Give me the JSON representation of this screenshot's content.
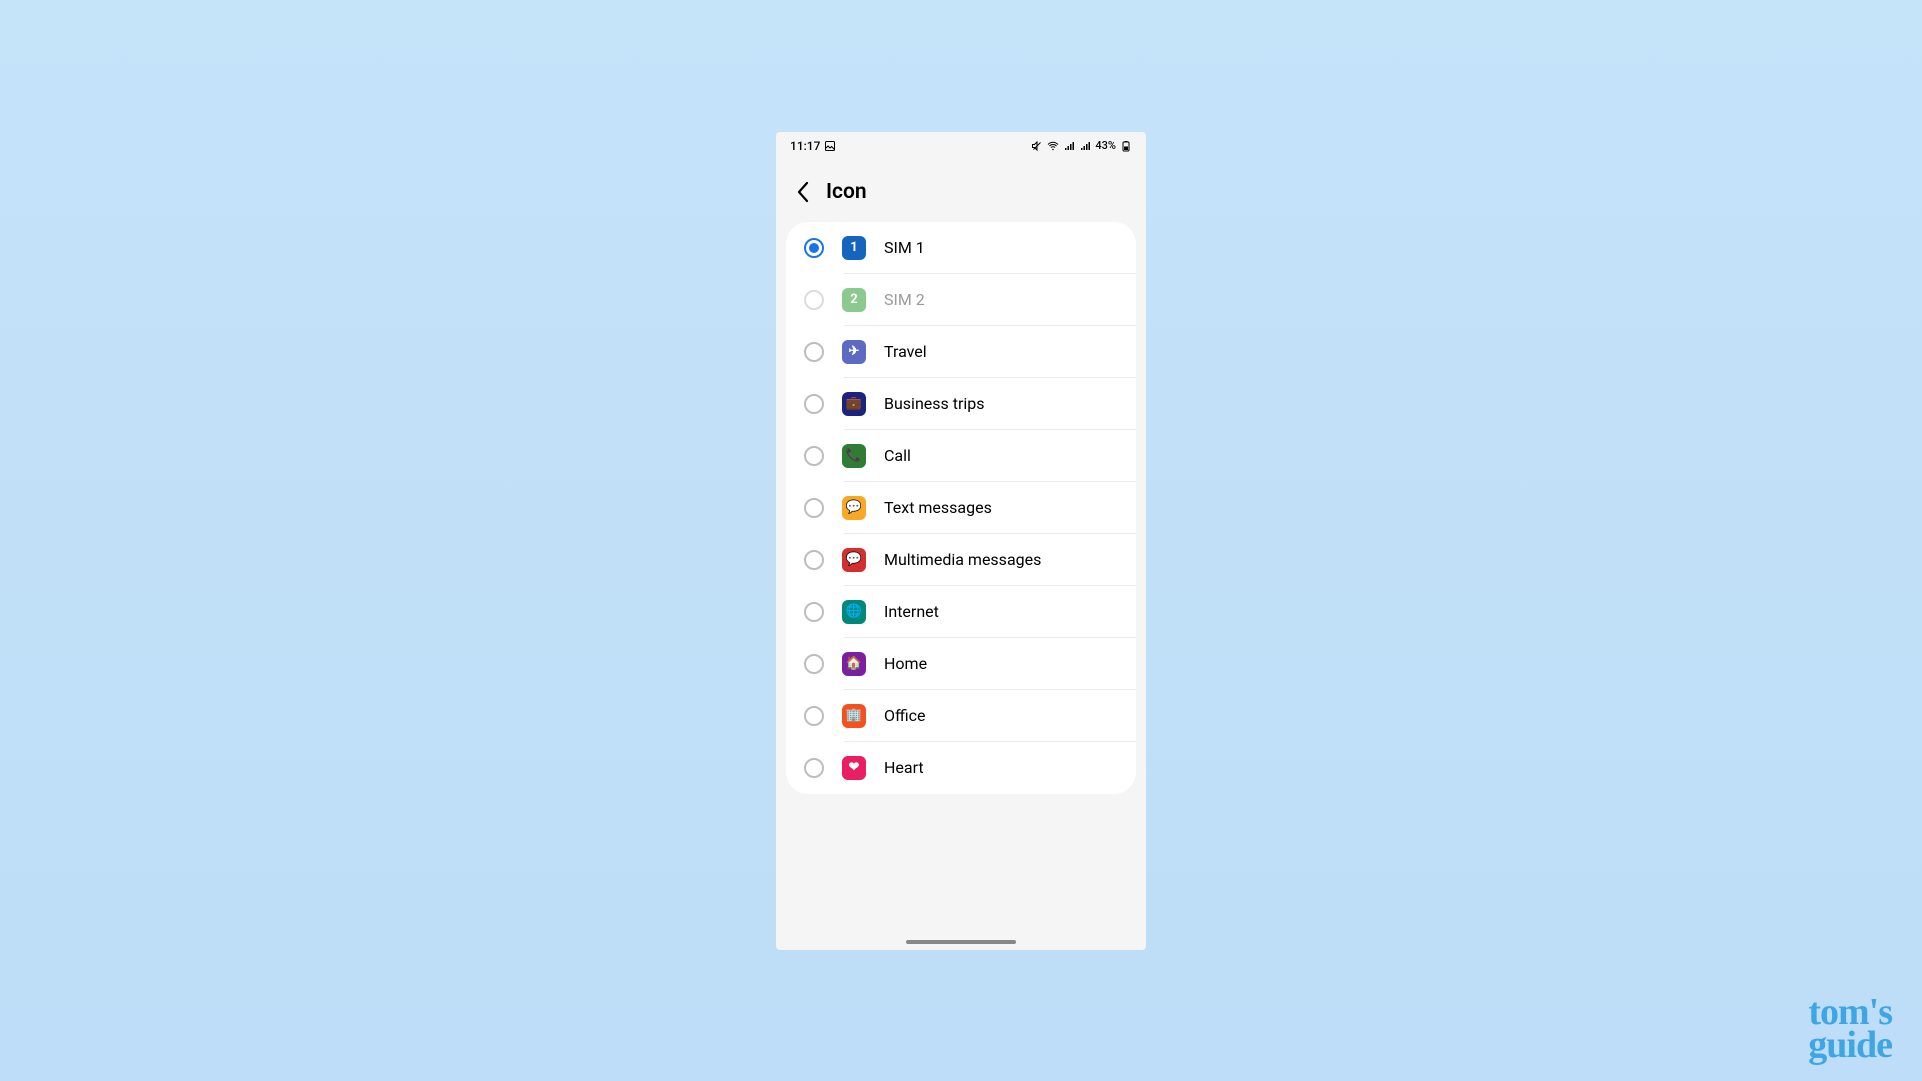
{
  "statusbar": {
    "time": "11:17",
    "battery": "43%"
  },
  "header": {
    "title": "Icon"
  },
  "options": [
    {
      "label": "SIM 1",
      "icon_text": "1",
      "color": "#1565c0",
      "selected": true,
      "disabled": false,
      "icon_name": "sim1-icon"
    },
    {
      "label": "SIM 2",
      "icon_text": "2",
      "color": "#8bc98f",
      "selected": false,
      "disabled": true,
      "icon_name": "sim2-icon"
    },
    {
      "label": "Travel",
      "icon_text": "✈",
      "color": "#5c6bc0",
      "selected": false,
      "disabled": false,
      "icon_name": "plane-icon"
    },
    {
      "label": "Business trips",
      "icon_text": "💼",
      "color": "#1a237e",
      "selected": false,
      "disabled": false,
      "icon_name": "briefcase-icon"
    },
    {
      "label": "Call",
      "icon_text": "📞",
      "color": "#2e7d32",
      "selected": false,
      "disabled": false,
      "icon_name": "phone-icon"
    },
    {
      "label": "Text messages",
      "icon_text": "💬",
      "color": "#f9a825",
      "selected": false,
      "disabled": false,
      "icon_name": "message-icon"
    },
    {
      "label": "Multimedia messages",
      "icon_text": "💬",
      "color": "#d32f2f",
      "selected": false,
      "disabled": false,
      "icon_name": "mms-icon"
    },
    {
      "label": "Internet",
      "icon_text": "🌐",
      "color": "#00897b",
      "selected": false,
      "disabled": false,
      "icon_name": "globe-icon"
    },
    {
      "label": "Home",
      "icon_text": "🏠",
      "color": "#7b1fa2",
      "selected": false,
      "disabled": false,
      "icon_name": "home-icon"
    },
    {
      "label": "Office",
      "icon_text": "🏢",
      "color": "#f4511e",
      "selected": false,
      "disabled": false,
      "icon_name": "office-icon"
    },
    {
      "label": "Heart",
      "icon_text": "❤",
      "color": "#e91e63",
      "selected": false,
      "disabled": false,
      "icon_name": "heart-icon"
    }
  ],
  "watermark": {
    "line1": "tom's",
    "line2": "guide"
  }
}
